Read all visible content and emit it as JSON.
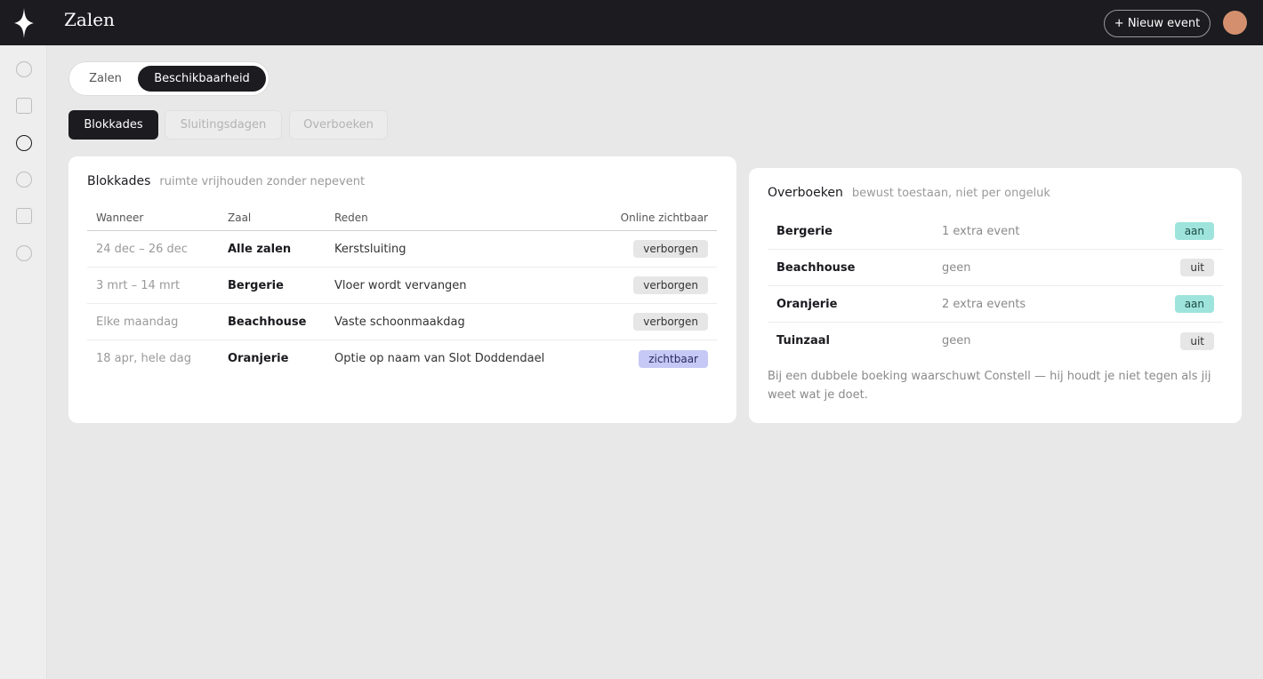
{
  "topbar": {
    "title": "Zalen",
    "new_event_label": "+ Nieuw event"
  },
  "segmented": {
    "options": [
      {
        "label": "Zalen",
        "active": false
      },
      {
        "label": "Beschikbaarheid",
        "active": true
      }
    ]
  },
  "subtabs": [
    {
      "label": "Blokkades",
      "active": true
    },
    {
      "label": "Sluitingsdagen",
      "active": false
    },
    {
      "label": "Overboeken",
      "active": false
    }
  ],
  "blokkades": {
    "title": "Blokkades",
    "subtitle": "ruimte vrijhouden zonder nepevent",
    "columns": [
      "Wanneer",
      "Zaal",
      "Reden",
      "Online zichtbaar"
    ],
    "rows": [
      {
        "when": "24 dec – 26 dec",
        "zaal": "Alle zalen",
        "reden": "Kerstsluiting",
        "visibility": "verborgen"
      },
      {
        "when": "3 mrt – 14 mrt",
        "zaal": "Bergerie",
        "reden": "Vloer wordt vervangen",
        "visibility": "verborgen"
      },
      {
        "when": "Elke maandag",
        "zaal": "Beachhouse",
        "reden": "Vaste schoonmaakdag",
        "visibility": "verborgen"
      },
      {
        "when": "18 apr, hele dag",
        "zaal": "Oranjerie",
        "reden": "Optie op naam van Slot Doddendael",
        "visibility": "zichtbaar"
      }
    ]
  },
  "overboeken": {
    "title": "Overboeken",
    "subtitle": "bewust toestaan, niet per ongeluk",
    "rows": [
      {
        "name": "Bergerie",
        "value": "1 extra event",
        "status": "aan"
      },
      {
        "name": "Beachhouse",
        "value": "geen",
        "status": "uit"
      },
      {
        "name": "Oranjerie",
        "value": "2 extra events",
        "status": "aan"
      },
      {
        "name": "Tuinzaal",
        "value": "geen",
        "status": "uit"
      }
    ],
    "note": "Bij een dubbele boeking waarschuwt Constell — hij houdt je niet tegen als jij weet wat je doet."
  },
  "colors": {
    "dark": "#1b1b20",
    "badge_on": "#9ee4dc",
    "badge_visible": "#c6c9f5",
    "avatar": "#d4906e"
  }
}
